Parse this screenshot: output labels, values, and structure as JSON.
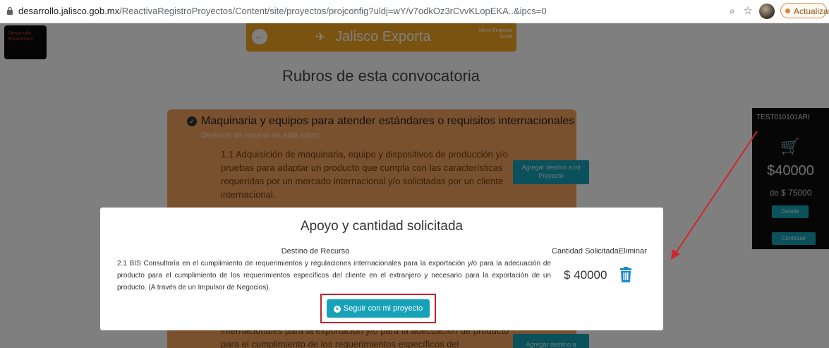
{
  "browser": {
    "url_domain": "desarrollo.jalisco.gob.mx",
    "url_path": "/ReactivaRegistroProyectos/Content/site/proyectos/projconfig?uldj=wY/v7odkOz3rCvvKLopEKA..&ipcs=0",
    "update_label": "Actualizar"
  },
  "header": {
    "logo_text": "Desarrollo Económico",
    "title": "Jalisco Exporta",
    "subtitle": "Micro Empresa Small"
  },
  "page": {
    "title": "Rubros de esta convocatoria",
    "rubro": {
      "title": "Maquinaria y equipos para atender estándares o requisitos internacionales",
      "subtitle": "Destinos de recurso en este rubro:",
      "item_text": "1.1 Adquisición de maquinaria, equipo y dispositivos de producción y/o pruebas para adaptar un producto que cumpla con las características requeridas por un mercado internacional y/o solicitadas por un cliente internacional.",
      "add_button": "Agregar destino a mi Proyecto",
      "item2_text": "internacionales para la exportación y/o para la adecuación de producto para el cumplimiento de los requerimientos específicos del",
      "add_button2": "Agregar destino a"
    }
  },
  "side_panel": {
    "user": "TEST010101ARI",
    "amount": "$40000",
    "of_amount": "de $ 75000",
    "detalle_label": "Detalle",
    "continuar_label": "Continuar"
  },
  "modal": {
    "title": "Apoyo y cantidad solicitada",
    "col_destino": "Destino de Recurso",
    "col_cantidad": "Cantidad Solicitada",
    "col_eliminar": "Eliminar",
    "destino_text": "2.1 BIS Consultoría en el cumplimiento de requerimientos y regulaciones internacionales para la exportación y/o para la adecuación de producto para el cumplimiento de los requerimientos específicos del cliente en el extranjero y necesario para la exportación de un producto. (A través de un Impulsor de Negocios).",
    "cantidad_value": "$ 40000",
    "seguir_label": "Seguir con mi proyecto"
  },
  "colors": {
    "accent": "#17a2b8",
    "header_orange": "#f5a623",
    "highlight_red": "#c0262b"
  }
}
